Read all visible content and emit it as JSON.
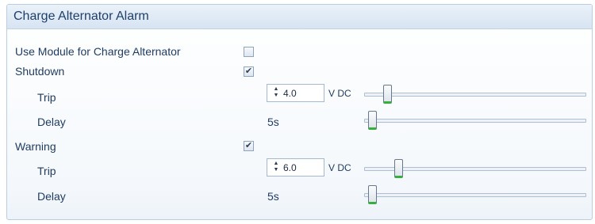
{
  "panel": {
    "title": "Charge Alternator Alarm"
  },
  "use_module": {
    "label": "Use Module for Charge Alternator",
    "checked": false
  },
  "shutdown": {
    "label": "Shutdown",
    "checked": true,
    "trip": {
      "label": "Trip",
      "value": "4.0",
      "unit": "V DC",
      "slider_fraction": 0.09
    },
    "delay": {
      "label": "Delay",
      "value": "5s",
      "slider_fraction": 0.02
    }
  },
  "warning": {
    "label": "Warning",
    "checked": true,
    "trip": {
      "label": "Trip",
      "value": "6.0",
      "unit": "V DC",
      "slider_fraction": 0.14
    },
    "delay": {
      "label": "Delay",
      "value": "5s",
      "slider_fraction": 0.02
    }
  },
  "icons": {
    "checkbox_checked": "check-mark",
    "spinner": "up-down-arrows"
  },
  "colors": {
    "header": "#dce8f5",
    "text": "#1e3a5f",
    "slider_accent": "#35b03a"
  }
}
